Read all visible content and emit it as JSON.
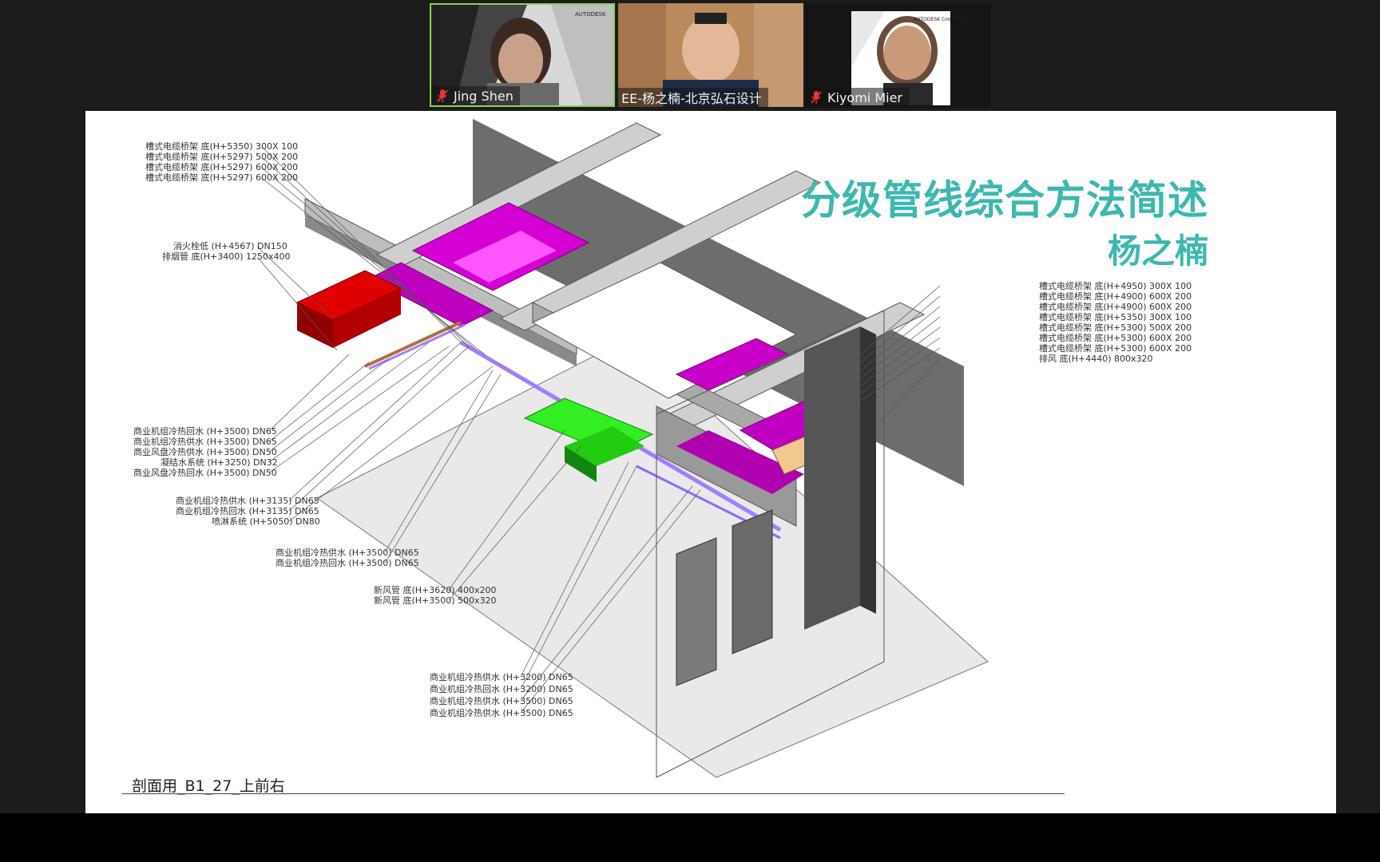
{
  "participants": [
    {
      "name": "Jing Shen",
      "muted": true,
      "active_speaker": true,
      "badge": "AUTODESK"
    },
    {
      "name": "EE-杨之楠-北京弘石设计",
      "muted": false,
      "active_speaker": false
    },
    {
      "name": "Kiyomi Mier",
      "muted": true,
      "active_speaker": false,
      "badge": "AUTODESK Community"
    }
  ],
  "slide": {
    "title": "分级管线综合方法简述",
    "author": "杨之楠",
    "view_name": "剖面用_B1_27_上前右",
    "labels_top_left": [
      "槽式电缆桥架 底(H+5350) 300X 100",
      "槽式电缆桥架 底(H+5297) 500X 200",
      "槽式电缆桥架 底(H+5297) 600X 200",
      "槽式电缆桥架 底(H+5297) 600X 200"
    ],
    "labels_mid_left": [
      "消火栓低 (H+4567) DN150",
      "排烟管 底(H+3400) 1250x400"
    ],
    "labels_right": [
      "槽式电缆桥架 底(H+4950) 300X 100",
      "槽式电缆桥架 底(H+4900) 600X 200",
      "槽式电缆桥架 底(H+4900) 600X 200",
      "槽式电缆桥架 底(H+5350) 300X 100",
      "槽式电缆桥架 底(H+5300) 500X 200",
      "槽式电缆桥架 底(H+5300) 600X 200",
      "槽式电缆桥架 底(H+5300) 600X 200",
      "排风 底(H+4440) 800x320"
    ],
    "labels_left_group1": [
      "商业机组冷热回水 (H+3500) DN65",
      "商业机组冷热供水 (H+3500) DN65",
      "商业风盘冷热供水 (H+3500) DN50",
      "凝结水系统 (H+3250) DN32",
      "商业风盘冷热回水 (H+3500) DN50"
    ],
    "labels_left_group2": [
      "商业机组冷热供水 (H+3135) DN65",
      "商业机组冷热回水 (H+3135) DN65",
      "喷淋系统 (H+5050) DN80"
    ],
    "labels_left_group3": [
      "商业机组冷热供水 (H+3500) DN65",
      "商业机组冷热回水 (H+3500) DN65"
    ],
    "labels_left_group4": [
      "新风管 底(H+3620) 400x200",
      "新风管 底(H+3500) 500x320"
    ],
    "labels_bottom": [
      "商业机组冷热供水 (H+3200) DN65",
      "商业机组冷热回水 (H+3200) DN65",
      "商业机组冷热供水 (H+3500) DN65",
      "商业机组冷热供水 (H+3500) DN65"
    ]
  },
  "colors": {
    "title": "#3cb8b0",
    "cable_tray": "#d400d4",
    "smoke_duct": "#c80000",
    "fresh_air": "#33ee22",
    "exhaust": "#f0c890",
    "pipes": "#9f7fff"
  }
}
